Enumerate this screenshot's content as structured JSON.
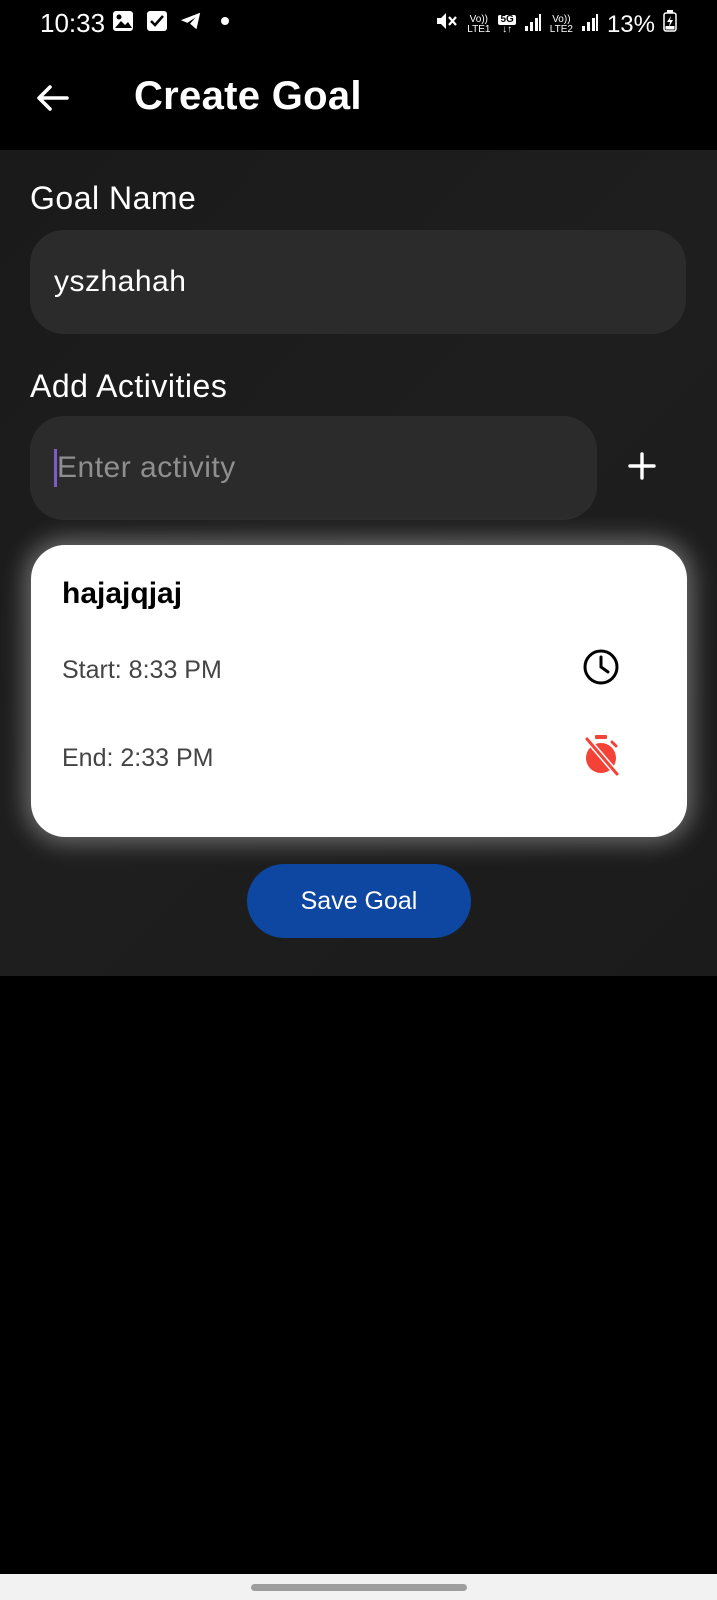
{
  "status_bar": {
    "time": "10:33",
    "battery": "13%",
    "net1_top": "Vo))",
    "net1_bottom": "LTE1",
    "net_5g": "5G",
    "net2_top": "Vo))",
    "net2_bottom": "LTE2"
  },
  "appbar": {
    "title": "Create Goal"
  },
  "form": {
    "goal_name_label": "Goal Name",
    "goal_name_value": "yszhahah",
    "activities_label": "Add Activities",
    "activity_placeholder": "Enter activity"
  },
  "activities": [
    {
      "title": "hajajqjaj",
      "start": "Start: 8:33 PM",
      "end": "End: 2:33 PM"
    }
  ],
  "actions": {
    "save_label": "Save Goal"
  },
  "colors": {
    "accent": "#0d47a1",
    "timer_off": "#f44336",
    "caret": "#7b5cc9"
  },
  "icons": {
    "back": "arrow-left-icon",
    "add": "plus-icon",
    "start_time": "clock-icon",
    "end_time": "timer-off-icon"
  }
}
